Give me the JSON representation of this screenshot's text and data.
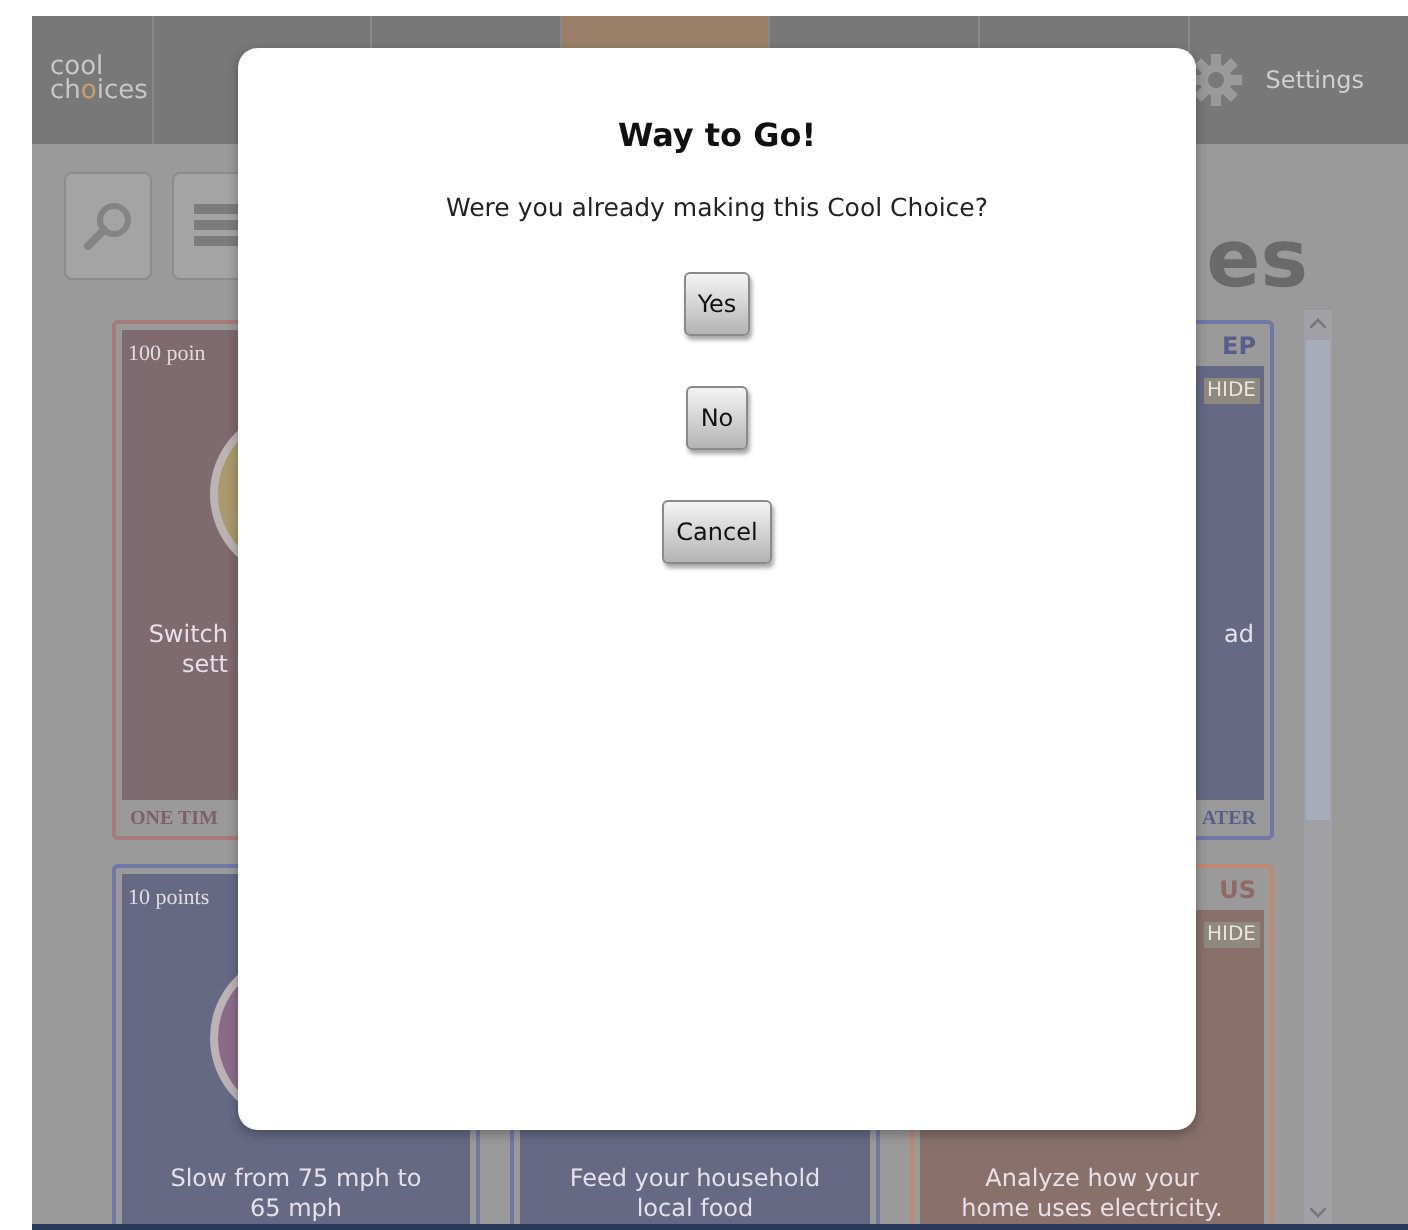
{
  "nav": {
    "logo": {
      "first": "cool",
      "second_start": "ch",
      "second_mark": "o",
      "second_end": "ices"
    },
    "tabs": [
      {
        "selected": false
      },
      {
        "selected": false
      },
      {
        "selected": true
      },
      {
        "selected": false
      },
      {
        "selected": false
      }
    ],
    "settings": "Settings"
  },
  "heading": "es",
  "cards": [
    {
      "kind": "strip-left",
      "color": "#a87a7a",
      "icon": {
        "color": "#a89a6c"
      },
      "points": "100 poin",
      "lines": [
        "Switch",
        "sett"
      ],
      "footer": "ONE TIM"
    },
    {
      "kind": "strip-right",
      "color": "#7078a8",
      "header": "EP",
      "tag": "HIDE",
      "lines": [
        "ad"
      ],
      "footer": "ATER"
    },
    {
      "kind": "full",
      "color": "#7078a8",
      "icon": {
        "color": "#8a6c88"
      },
      "points": "10 points",
      "lines": [
        "Slow from 75 mph to",
        "65 mph"
      ]
    },
    {
      "kind": "full",
      "color": "#7078a8",
      "lines": [
        "Feed your household",
        "local food"
      ]
    },
    {
      "kind": "full",
      "color": "#c08870",
      "header": "US",
      "tag": "HIDE",
      "lines": [
        "Analyze how your",
        "home uses electricity."
      ]
    }
  ],
  "dialog": {
    "title": "Way to Go!",
    "message": "Were you already making this Cool Choice?",
    "buttons": [
      "Yes",
      "No",
      "Cancel"
    ]
  }
}
